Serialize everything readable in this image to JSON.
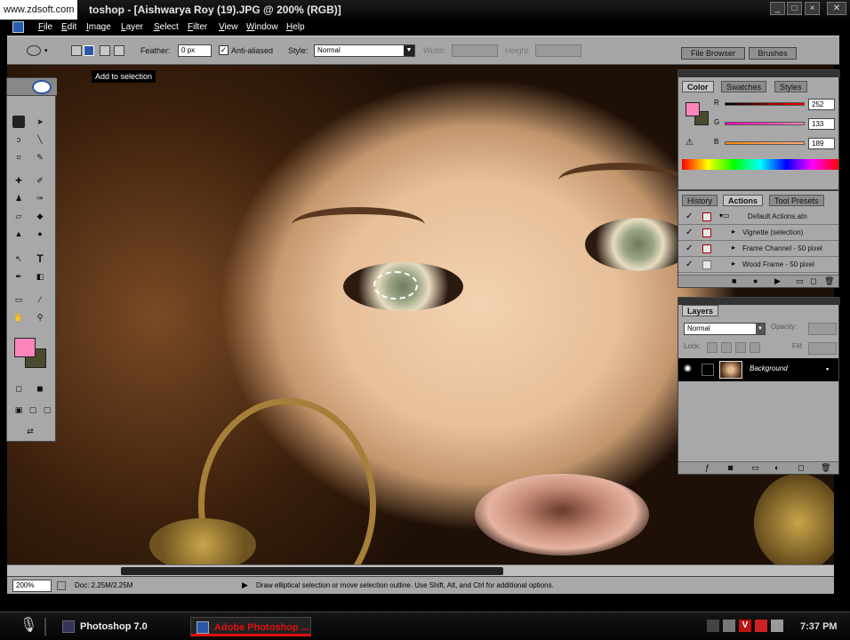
{
  "watermark": "www.zdsoft.com",
  "window": {
    "title": "toshop - [Aishwarya Roy (19).JPG @ 200% (RGB)]",
    "controls": [
      "_",
      "□",
      "×"
    ]
  },
  "menu": [
    "File",
    "Edit",
    "Image",
    "Layer",
    "Select",
    "Filter",
    "View",
    "Window",
    "Help"
  ],
  "options": {
    "feather_label": "Feather:",
    "feather_value": "0 px",
    "antialiased_label": "Anti-aliased",
    "antialiased_checked": true,
    "style_label": "Style:",
    "style_value": "Normal",
    "width_label": "Width:",
    "height_label": "Height:",
    "file_browser_tab": "File Browser",
    "brushes_tab": "Brushes"
  },
  "tooltip": "Add to selection",
  "color_panel": {
    "tabs": [
      "Color",
      "Swatches",
      "Styles"
    ],
    "channels": [
      {
        "label": "R",
        "value": "252"
      },
      {
        "label": "G",
        "value": "133"
      },
      {
        "label": "B",
        "value": "189"
      }
    ],
    "foreground_color": "#fc85bd",
    "background_color": "#4a4a30"
  },
  "actions_panel": {
    "tabs": [
      "History",
      "Actions",
      "Tool Presets"
    ],
    "items": [
      {
        "label": "Default Actions.atn",
        "type": "set"
      },
      {
        "label": "Vignette (selection)",
        "type": "action"
      },
      {
        "label": "Frame Channel - 50 pixel",
        "type": "action"
      },
      {
        "label": "Wood Frame - 50 pixel",
        "type": "action"
      }
    ]
  },
  "layers_panel": {
    "tab": "Layers",
    "blend_mode": "Normal",
    "opacity_label": "Opacity:",
    "lock_label": "Lock:",
    "fill_label": "Fill:",
    "layers": [
      {
        "name": "Background"
      }
    ]
  },
  "status": {
    "zoom": "200%",
    "doc": "Doc: 2.25M/2.25M",
    "hint": "Draw elliptical selection or move selection outline. Use Shift, Alt, and Ctrl for additional options."
  },
  "taskbar": {
    "items": [
      "Photoshop 7.0",
      "Adobe Photoshop ..."
    ],
    "clock": "7:37 PM"
  },
  "colors": {
    "panel": "#a8a8a8",
    "accent_red": "#e01010",
    "fg_swatch": "#fc85bd"
  }
}
